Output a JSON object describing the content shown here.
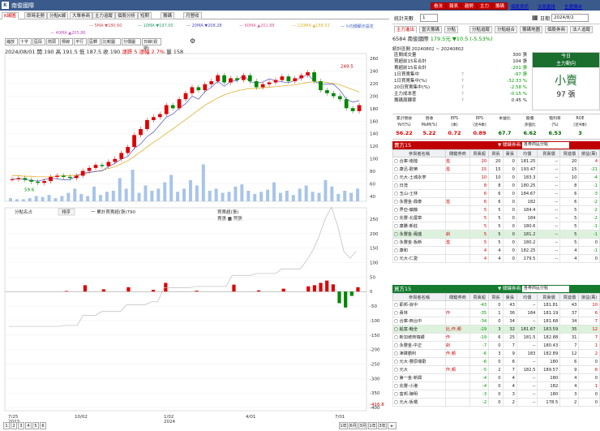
{
  "window": {
    "title": "南俊國際",
    "icon": "K"
  },
  "top_buttons": [
    "看法",
    "報表",
    "趨勢",
    "主力",
    "籌碼"
  ],
  "top_links": [
    "個股資訊",
    "交易量排",
    "全選擇台"
  ],
  "tabs": [
    "K線圖",
    "即時走勢",
    "分點K線",
    "大單券商",
    "主力追蹤",
    "個股分析",
    "短期",
    "籌碼",
    "月營收"
  ],
  "ma_legend": [
    {
      "label": "5MA ▼180.60",
      "color": "#d05050"
    },
    {
      "label": "10MA ▼197.00",
      "color": "#30a070"
    },
    {
      "label": "20MA ▼208.28",
      "color": "#5050c0"
    },
    {
      "label": "60MA ▲201.88",
      "color": "#e06090"
    },
    {
      "label": "120MA ▲158.52",
      "color": "#e0b030"
    },
    {
      "label": "↻均價顯示設定",
      "color": "#4060c0"
    },
    {
      "label": "40MA ▲205.86",
      "color": "#c050c0"
    }
  ],
  "toolbar": [
    "縮放",
    "十字",
    "區段",
    "箭頭",
    "標線",
    "平行",
    "區轉",
    "比較圖",
    "分價圖",
    "日線(週期)"
  ],
  "ohlc": {
    "date": "2024/08/01",
    "open": "開 190",
    "high": "高 191.5",
    "low": "低 187.5",
    "close": "收 190",
    "chg": "漲跌 5",
    "pct": "漲幅 2.7%",
    "vol": "量 158"
  },
  "chart_price": {
    "y_ticks": [
      "260",
      "240",
      "220",
      "200",
      "180",
      "160",
      "140",
      "120",
      "100",
      "80",
      "60",
      "40"
    ],
    "max_label": "249.5",
    "min_label": "59.6",
    "price": [
      66,
      68,
      65,
      62,
      60,
      63,
      70,
      72,
      70,
      68,
      72,
      80,
      85,
      90,
      88,
      95,
      100,
      110,
      120,
      140,
      150,
      165,
      170,
      175,
      190,
      185,
      200,
      210,
      220,
      215,
      225,
      230,
      240,
      228,
      235,
      232,
      240,
      230,
      220,
      225,
      228,
      232,
      238,
      230,
      235,
      240,
      245,
      230,
      215,
      210,
      205,
      200,
      185,
      180,
      190
    ],
    "vol": [
      3,
      2,
      2,
      3,
      5,
      4,
      6,
      3,
      5,
      8,
      12,
      7,
      5,
      14,
      6,
      9,
      10,
      22,
      12,
      30,
      8,
      15,
      10,
      12,
      18,
      25,
      9,
      12,
      20,
      15,
      35,
      10,
      12,
      8,
      9,
      14,
      16,
      10,
      7,
      9,
      11,
      18,
      8,
      10,
      6,
      12,
      15,
      9,
      8,
      20,
      14,
      7,
      10,
      8,
      12
    ],
    "ma20": [
      72,
      72,
      71,
      71,
      70,
      70,
      70,
      71,
      72,
      72,
      73,
      75,
      77,
      79,
      81,
      84,
      87,
      92,
      97,
      104,
      112,
      120,
      128,
      135,
      143,
      150,
      158,
      166,
      174,
      182,
      190,
      196,
      202,
      207,
      211,
      214,
      216,
      218,
      218,
      219,
      220,
      221,
      222,
      223,
      224,
      226,
      228,
      229,
      229,
      228,
      226,
      224,
      220,
      216,
      212
    ]
  },
  "sub_label": "分點名占",
  "sub_btn": "排序",
  "sub_title": "一 累計買賣超(張)790",
  "sub_legend": [
    "買賣超(張)",
    "賣張 ■ 買張"
  ],
  "sub_y": [
    "250",
    "200",
    "150",
    "100",
    "50",
    "0",
    "-50",
    "-100",
    "-150",
    "-200",
    "-250",
    "-300",
    "-350",
    "-400"
  ],
  "sub_min": "-416.8",
  "sub_bars": [
    0,
    0,
    0,
    0,
    0,
    0,
    0,
    0,
    0,
    2,
    0,
    0,
    22,
    0,
    0,
    8,
    0,
    0,
    0,
    15,
    0,
    0,
    0,
    6,
    0,
    30,
    0,
    0,
    0,
    0,
    3,
    0,
    0,
    0,
    0,
    0,
    24,
    0,
    0,
    0,
    4,
    0,
    0,
    0,
    10,
    0,
    0,
    0,
    18,
    22,
    30,
    38,
    25,
    -40,
    -55,
    -15,
    15
  ],
  "x_labels": [
    "7/25\n2023",
    "10/02",
    "1/02\n2024",
    "4/01",
    "7/01"
  ],
  "pages": [
    "1",
    "2",
    "3",
    "4",
    "5",
    "6"
  ],
  "bottom_ctrl": [
    "1年",
    "6月",
    "3月",
    "1年",
    "3年",
    "▸"
  ],
  "right": {
    "stat_label": "統計天數",
    "stat_val": "1",
    "date_label": "日期",
    "date_val": "2024/8/2",
    "subtabs": [
      "主力進出",
      "當天籌碼",
      "分點",
      "分點追蹤",
      "分點組合",
      "籌碼地圖",
      "個股券商",
      "法人追蹤"
    ],
    "stock": "6584 南俊國際",
    "price": "179.5元",
    "chg": "▼10.5 (-5.53%)",
    "period": "統計區間  20240802 ~ 20240802",
    "summary": [
      {
        "k": "區間成交量",
        "q": "",
        "v": "300 張"
      },
      {
        "k": "買超前15名合計",
        "q": "",
        "v": "104 張"
      },
      {
        "k": "賣超前15名合計",
        "q": "",
        "v": "-201 張"
      },
      {
        "k": "1日買賣集中",
        "q": "?",
        "v": "-97 張"
      },
      {
        "k": "1日買賣集中(%)",
        "q": "?",
        "v": "-32.33 %"
      },
      {
        "k": "20日買賣集中(%)",
        "q": "?",
        "v": "-2.58 %"
      },
      {
        "k": "主力成本差",
        "q": "?",
        "v": "-0.15 %"
      },
      {
        "k": "籌碼周轉率",
        "q": "?",
        "v": "0.45 %"
      }
    ],
    "today": {
      "title": "今日",
      "sub": "主力動向",
      "action": "小賣",
      "count": "97 張"
    },
    "fund": [
      {
        "h": "累計營收\nYoY(%)",
        "v": "56.22"
      },
      {
        "h": "營收\nMoM(%)",
        "v": "5.22"
      },
      {
        "h": "EPS\n(季)",
        "v": "0.72"
      },
      {
        "h": "EPS\n(近4季)",
        "v": "0.89"
      },
      {
        "h": "本益比",
        "v": "67.7"
      },
      {
        "h": "股價\n淨值比",
        "v": "6.62"
      },
      {
        "h": "殖利率\n(%)",
        "v": "6.53"
      },
      {
        "h": "ROE\n(近4季)",
        "v": "3"
      }
    ],
    "buy": {
      "title": "賣方15",
      "label": "▼ 關鍵券商:",
      "sel": "各券商區分點",
      "cols": [
        "參與者名稱",
        "關鍵券商",
        "買賣超",
        "買張",
        "賣張",
        "均價",
        "買賣價",
        "買進價",
        "損益(萬)"
      ],
      "rows": [
        [
          "合庫-南陸",
          "濫",
          "20",
          "20",
          "0",
          "181.25",
          "--",
          "20",
          "4"
        ],
        [
          "康迅-歡樂",
          "濫",
          "15",
          "15",
          "0",
          "193.47",
          "--",
          "15",
          "-21"
        ],
        [
          "元大-土城永寧",
          "",
          "10",
          "10",
          "0",
          "183.3",
          "--",
          "10",
          "-4"
        ],
        [
          "日茂",
          "",
          "8",
          "8",
          "0",
          "180.25",
          "--",
          "8",
          "-1"
        ],
        [
          "玉山-士林",
          "",
          "6",
          "6",
          "0",
          "184.67",
          "--",
          "6",
          "-3"
        ],
        [
          "永豐金-鼎泰",
          "濫",
          "6",
          "6",
          "0",
          "182",
          "--",
          "6",
          "-2"
        ],
        [
          "界亞-鎮藤",
          "",
          "5",
          "5",
          "0",
          "184.4",
          "--",
          "5",
          "-2"
        ],
        [
          "兆豐-北屋章",
          "",
          "5",
          "5",
          "0",
          "184",
          "--",
          "5",
          "-2"
        ],
        [
          "康勝-新莊",
          "",
          "5",
          "5",
          "0",
          "180.6",
          "--",
          "5",
          "-1"
        ],
        [
          "永豐金-鳳盛",
          "剎",
          "5",
          "5",
          "0",
          "181.2",
          "--",
          "5",
          "-1"
        ],
        [
          "永豐金-板新",
          "濫",
          "5",
          "5",
          "0",
          "180.2",
          "--",
          "5",
          "0"
        ],
        [
          "康和",
          "",
          "4",
          "4",
          "0",
          "182.25",
          "--",
          "4",
          "-1"
        ],
        [
          "元大-仁愛",
          "",
          "4",
          "4",
          "0",
          "179.5",
          "--",
          "4",
          "0"
        ]
      ]
    },
    "sell": {
      "title": "買方15",
      "label": "▼ 關鍵券商:",
      "sel": "各券商區分點",
      "cols": [
        "參與者名稱",
        "關鍵券商",
        "買賣超",
        "買張",
        "賣張",
        "均價",
        "買賣價",
        "買進價",
        "損益(萬)"
      ],
      "rows": [
        [
          "耶邦-資中",
          "",
          "-43",
          "0",
          "43",
          "--",
          "181.81",
          "43",
          "10"
        ],
        [
          "黃林",
          "作",
          "-35",
          "1",
          "36",
          "184",
          "181.19",
          "37",
          "6"
        ],
        [
          "合庫-西台中",
          "",
          "-34",
          "0",
          "34",
          "--",
          "181.68",
          "34",
          "7"
        ],
        [
          "船富-翰全",
          "比,作,頻",
          "-29",
          "3",
          "32",
          "181.67",
          "183.59",
          "35",
          "12"
        ],
        [
          "新加坡商瑞銀",
          "作",
          "-19",
          "6",
          "25",
          "181.5",
          "182.88",
          "31",
          "7"
        ],
        [
          "永豐金-中正",
          "剎",
          "-7",
          "0",
          "7",
          "--",
          "180.43",
          "7",
          "1"
        ],
        [
          "凍碟霸利",
          "作,頻",
          "-6",
          "3",
          "9",
          "183",
          "182.89",
          "12",
          "2"
        ],
        [
          "元大-豐原瑞歡",
          "",
          "-6",
          "0",
          "6",
          "--",
          "180",
          "6",
          "0"
        ],
        [
          "元大",
          "作,頻",
          "-5",
          "2",
          "7",
          "182.5",
          "189.57",
          "9",
          "6"
        ],
        [
          "第一金-新興",
          "",
          "-4",
          "0",
          "4",
          "--",
          "180",
          "4",
          "0"
        ],
        [
          "兆豐-小港",
          "",
          "-4",
          "0",
          "4",
          "--",
          "182",
          "4",
          "1"
        ],
        [
          "富邦-陳明",
          "",
          "-3",
          "0",
          "3",
          "--",
          "180",
          "3",
          "0"
        ],
        [
          "元大-板橋",
          "",
          "-2",
          "0",
          "2",
          "--",
          "178.5",
          "2",
          "0"
        ]
      ]
    }
  }
}
